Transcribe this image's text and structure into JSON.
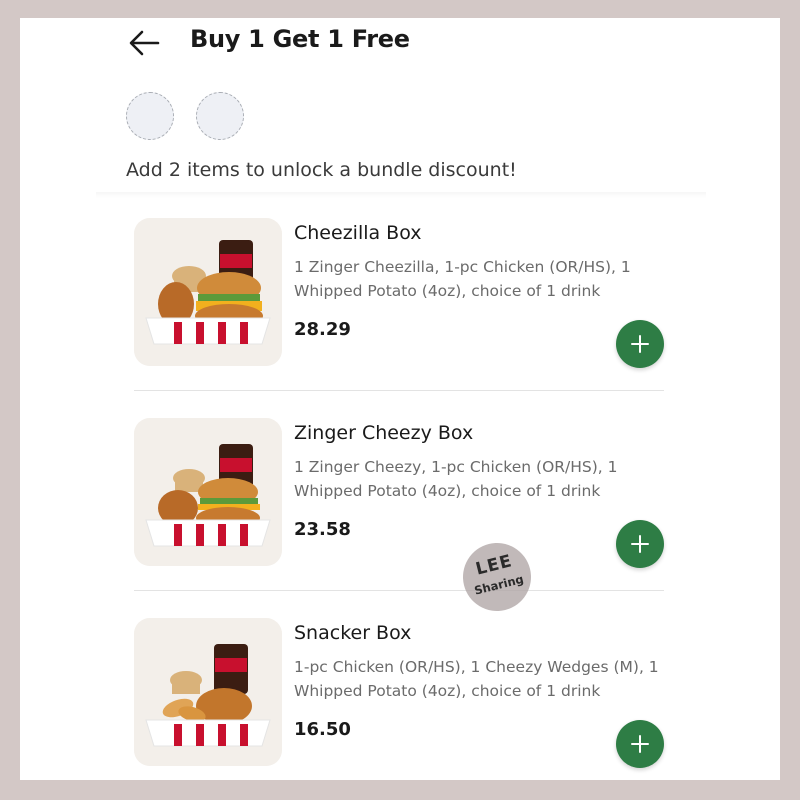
{
  "header": {
    "title": "Buy 1 Get 1 Free",
    "back_icon": "arrow-left-icon"
  },
  "bundle": {
    "slot_count": 2,
    "hint": "Add 2 items to unlock a bundle discount!"
  },
  "items": [
    {
      "name": "Cheezilla Box",
      "description": "1 Zinger Cheezilla, 1-pc Chicken (OR/HS), 1 Whipped Potato (4oz), choice of 1 drink",
      "price": "28.29",
      "image_icon": "cheezilla-box-photo"
    },
    {
      "name": "Zinger Cheezy Box",
      "description": "1 Zinger Cheezy, 1-pc Chicken (OR/HS), 1 Whipped Potato (4oz), choice of 1 drink",
      "price": "23.58",
      "image_icon": "zinger-cheezy-box-photo"
    },
    {
      "name": "Snacker Box",
      "description": "1-pc Chicken (OR/HS), 1 Cheezy Wedges (M), 1 Whipped Potato (4oz), choice of 1 drink",
      "price": "16.50",
      "image_icon": "snacker-box-photo"
    }
  ],
  "watermark": {
    "line1": "LEE",
    "line2": "Sharing"
  },
  "colors": {
    "accent": "#2e7d45",
    "frame": "#d3c8c6",
    "text_primary": "#1a1a1a",
    "text_secondary": "#6b6b6b"
  }
}
